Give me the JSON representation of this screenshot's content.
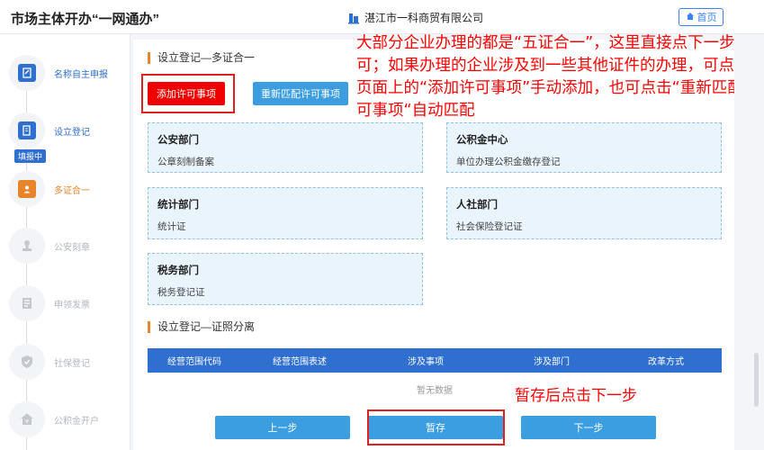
{
  "header": {
    "app_title": "市场主体开办“一网通办”",
    "company": "湛江市一科商贸有限公司",
    "home_label": "首页"
  },
  "sidebar": {
    "badge": "填报中",
    "steps": [
      {
        "label": "名称自主申报",
        "icon": "edit-doc-icon",
        "state": "done"
      },
      {
        "label": "设立登记",
        "icon": "form-edit-icon",
        "state": "active"
      },
      {
        "label": "多证合一",
        "icon": "id-card-icon",
        "state": "current"
      },
      {
        "label": "公安刻章",
        "icon": "stamp-icon",
        "state": "pending"
      },
      {
        "label": "申领发票",
        "icon": "invoice-icon",
        "state": "pending"
      },
      {
        "label": "社保登记",
        "icon": "shield-icon",
        "state": "pending"
      },
      {
        "label": "公积金开户",
        "icon": "house-fund-icon",
        "state": "pending"
      }
    ]
  },
  "main": {
    "section1_title": "设立登记—多证合一",
    "add_permit_label": "添加许可事项",
    "rematch_permit_label": "重新匹配许可事项",
    "cards": [
      {
        "title": "公安部门",
        "sub": "公章刻制备案"
      },
      {
        "title": "公积金中心",
        "sub": "单位办理公积金缴存登记"
      },
      {
        "title": "统计部门",
        "sub": "统计证"
      },
      {
        "title": "人社部门",
        "sub": "社会保险登记证"
      },
      {
        "title": "税务部门",
        "sub": "税务登记证"
      }
    ],
    "section2_title": "设立登记—证照分离",
    "table_headers": [
      "经营范围代码",
      "经营范围表述",
      "涉及事项",
      "涉及部门",
      "改革方式"
    ],
    "no_data": "暂无数据",
    "prev_label": "上一步",
    "save_label": "暂存",
    "next_label": "下一步"
  },
  "annotations": {
    "main_note": "大部分企业办理的都是“五证合一”，这里直接点下一步即可；如果办理的企业涉及到一些其他证件的办理，可点击页面上的“添加许可事项”手动添加，也可点击“重新匹配许可事项“自动匹配",
    "save_note": "暂存后点击下一步"
  },
  "colors": {
    "primary_blue": "#2f6fcf",
    "button_blue": "#3a9ee0",
    "red": "#f00000",
    "orange": "#e8852a"
  }
}
